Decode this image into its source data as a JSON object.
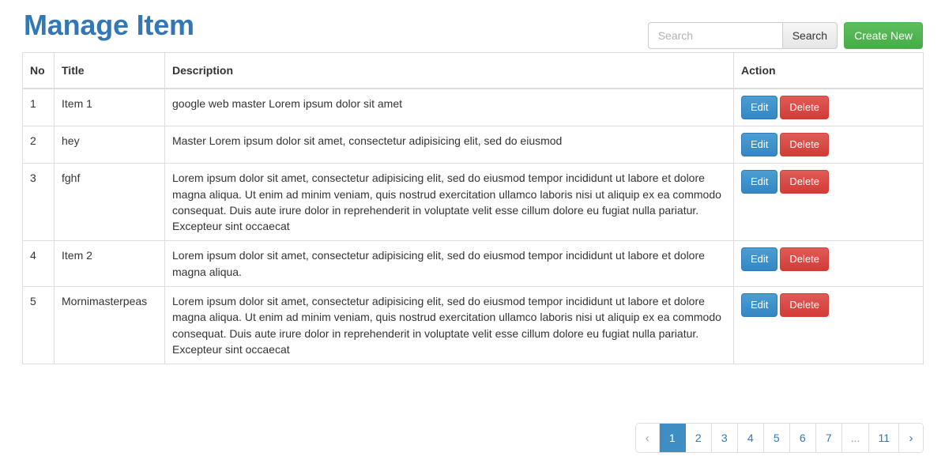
{
  "header": {
    "title": "Manage Item",
    "search": {
      "placeholder": "Search",
      "value": "",
      "button_label": "Search"
    },
    "create_button_label": "Create New"
  },
  "table": {
    "columns": [
      "No",
      "Title",
      "Description",
      "Action"
    ],
    "rows": [
      {
        "no": "1",
        "title": "Item 1",
        "description": "google web master Lorem ipsum dolor sit amet",
        "edit_label": "Edit",
        "delete_label": "Delete"
      },
      {
        "no": "2",
        "title": "hey",
        "description": "Master Lorem ipsum dolor sit amet, consectetur adipisicing elit, sed do eiusmod",
        "edit_label": "Edit",
        "delete_label": "Delete"
      },
      {
        "no": "3",
        "title": "fghf",
        "description": "Lorem ipsum dolor sit amet, consectetur adipisicing elit, sed do eiusmod tempor incididunt ut labore et dolore magna aliqua. Ut enim ad minim veniam, quis nostrud exercitation ullamco laboris nisi ut aliquip ex ea commodo consequat. Duis aute irure dolor in reprehenderit in voluptate velit esse cillum dolore eu fugiat nulla pariatur. Excepteur sint occaecat",
        "edit_label": "Edit",
        "delete_label": "Delete"
      },
      {
        "no": "4",
        "title": "Item 2",
        "description": "Lorem ipsum dolor sit amet, consectetur adipisicing elit, sed do eiusmod tempor incididunt ut labore et dolore magna aliqua.",
        "edit_label": "Edit",
        "delete_label": "Delete"
      },
      {
        "no": "5",
        "title": "Mornimasterpeas",
        "description": "Lorem ipsum dolor sit amet, consectetur adipisicing elit, sed do eiusmod tempor incididunt ut labore et dolore magna aliqua. Ut enim ad minim veniam, quis nostrud exercitation ullamco laboris nisi ut aliquip ex ea commodo consequat. Duis aute irure dolor in reprehenderit in voluptate velit esse cillum dolore eu fugiat nulla pariatur. Excepteur sint occaecat",
        "edit_label": "Edit",
        "delete_label": "Delete"
      }
    ]
  },
  "pagination": {
    "prev_label": "‹",
    "next_label": "›",
    "items": [
      {
        "label": "1",
        "state": "active"
      },
      {
        "label": "2",
        "state": "normal"
      },
      {
        "label": "3",
        "state": "normal"
      },
      {
        "label": "4",
        "state": "normal"
      },
      {
        "label": "5",
        "state": "normal"
      },
      {
        "label": "6",
        "state": "normal"
      },
      {
        "label": "7",
        "state": "normal"
      },
      {
        "label": "...",
        "state": "disabled"
      },
      {
        "label": "11",
        "state": "normal"
      }
    ]
  },
  "colors": {
    "title_blue": "#3378b5",
    "primary_blue": "#3e93cc",
    "danger_red": "#d9534f",
    "success_green": "#51b551",
    "border_gray": "#dddddd"
  }
}
